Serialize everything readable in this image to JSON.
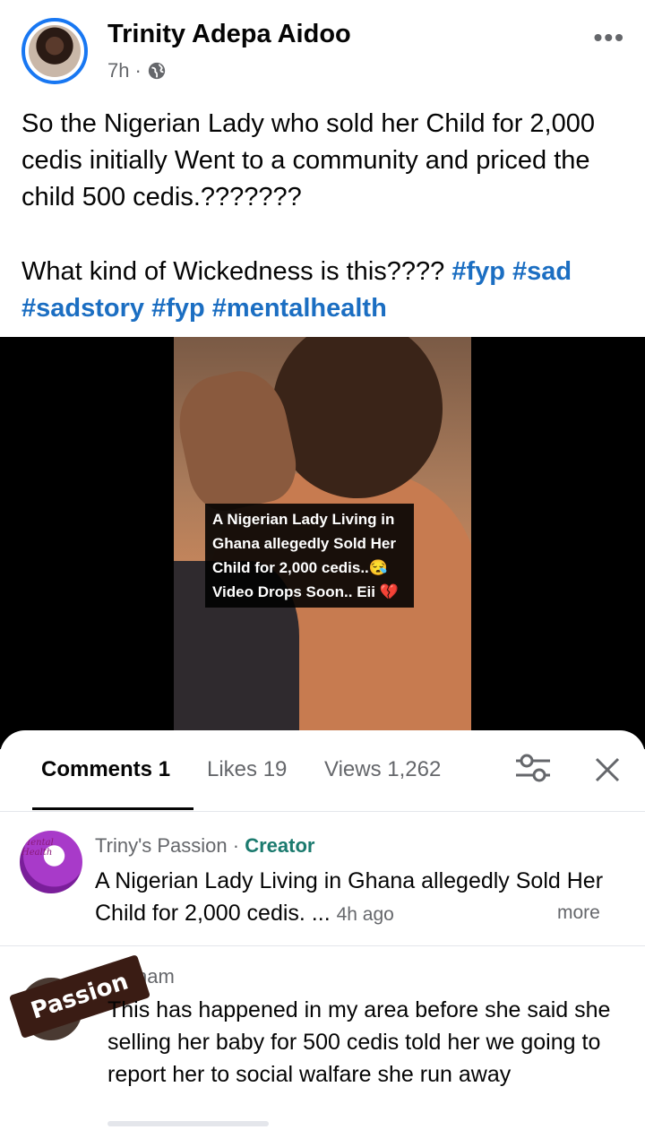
{
  "post": {
    "author": "Trinity Adepa Aidoo",
    "time": "7h",
    "separator": "·",
    "privacy_icon": "globe-icon",
    "more_icon": "more-dots-icon",
    "caption_line1": "So the Nigerian Lady who sold her Child for 2,000 cedis initially Went to a community and priced the child 500 cedis.???????",
    "caption_line2": "What kind of Wickedness is this???? ",
    "hashtags": [
      "#fyp",
      "#sad",
      "#sadstory",
      "#fyp",
      "#mentalhealth"
    ]
  },
  "video": {
    "overlay_lines": [
      "A Nigerian Lady Living in",
      "Ghana allegedly Sold Her",
      "Child for 2,000 cedis..😪",
      "Video Drops Soon.. Eii 💔"
    ]
  },
  "comments_panel": {
    "tabs": [
      {
        "label": "Comments 1",
        "active": true
      },
      {
        "label": "Likes 19",
        "active": false
      },
      {
        "label": "Views 1,262",
        "active": false
      }
    ],
    "filter_icon": "filter-sliders-icon",
    "close_icon": "close-icon",
    "comments": [
      {
        "author": "Triny's Passion",
        "dot": " · ",
        "badge": "Creator",
        "text": "A Nigerian Lady Living in Ghana allegedly Sold Her Child for 2,000 cedis. ...",
        "time": "4h ago",
        "more": "more",
        "avatar_caption": "Mental Health"
      },
      {
        "author_partial": "nam",
        "text": "This has happened in my area before she said she selling her baby for 500 cedis told her we going to report her to social walfare she run away",
        "sticker": "Passion"
      }
    ]
  }
}
